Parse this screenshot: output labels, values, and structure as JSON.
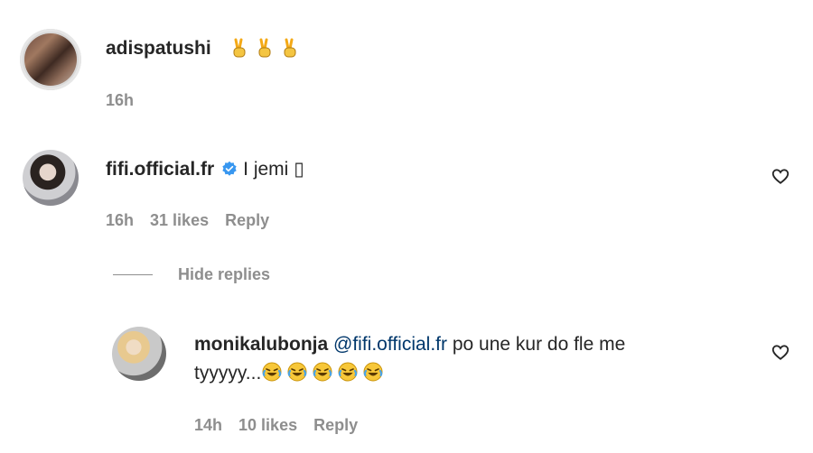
{
  "comments": [
    {
      "username": "adispatushi",
      "text": "",
      "emoji": [
        "victory-hand",
        "victory-hand",
        "victory-hand"
      ],
      "time": "16h"
    },
    {
      "username": "fifi.official.fr",
      "verified": true,
      "text": "I jemi ",
      "text_glyph": "▯",
      "time": "16h",
      "likes": "31 likes",
      "reply_label": "Reply",
      "hide_replies_label": "Hide replies"
    },
    {
      "username": "monikalubonja",
      "mention": "@fifi.official.fr",
      "text_line1": " po une kur do fle me",
      "text_line2": "tyyyyy...",
      "emoji": [
        "laughing-tears",
        "laughing-tears",
        "laughing-tears",
        "laughing-tears",
        "laughing-tears"
      ],
      "time": "14h",
      "likes": "10 likes",
      "reply_label": "Reply"
    }
  ],
  "colors": {
    "text": "#262626",
    "meta": "#8e8e8e",
    "mention": "#00376b",
    "verified": "#3897f0"
  }
}
